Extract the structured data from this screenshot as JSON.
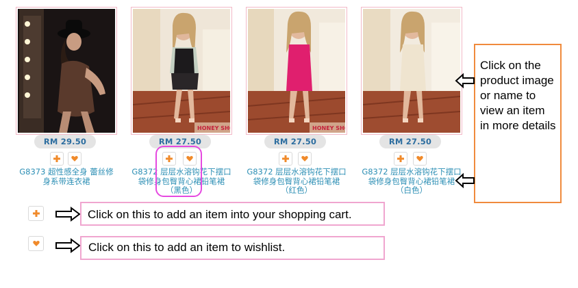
{
  "products": [
    {
      "price": "RM 29.50",
      "name": "G8373 超性感全身 蕾丝修身系带连衣裙",
      "image": "model-in-black-hat"
    },
    {
      "price": "RM 27.50",
      "name": "G8372 层层水溶钩花下摆口袋修身包臀背心裙铅笔裙（黑色）",
      "image": "model-in-black-dress"
    },
    {
      "price": "RM 27.50",
      "name": "G8372 层层水溶钩花下摆口袋修身包臀背心裙铅笔裙（红色）",
      "image": "model-in-pink-dress"
    },
    {
      "price": "RM 27.50",
      "name": "G8372 层层水溶钩花下摆口袋修身包臀背心裙铅笔裙（白色）",
      "image": "model-in-white-dress"
    }
  ],
  "watermark": "HONEY SHOP",
  "side_note": "Click on the product image or name to view an item in more details",
  "legend": {
    "cart_text": "Click on this to add an item into your shopping cart.",
    "wishlist_text": "Click on this to add an item to wishlist."
  },
  "icons": {
    "cart": "plus-icon",
    "wishlist": "heart-icon",
    "arrow": "right-arrow-icon",
    "arrow_left": "left-arrow-icon"
  },
  "colors": {
    "accent_orange": "#f08a3c",
    "callout_pink": "#f0a5cf",
    "highlight_magenta": "#e548e0",
    "link_blue": "#2d8fb5",
    "price_blue": "#2d6ea0",
    "image_border": "#f2b8c6"
  }
}
